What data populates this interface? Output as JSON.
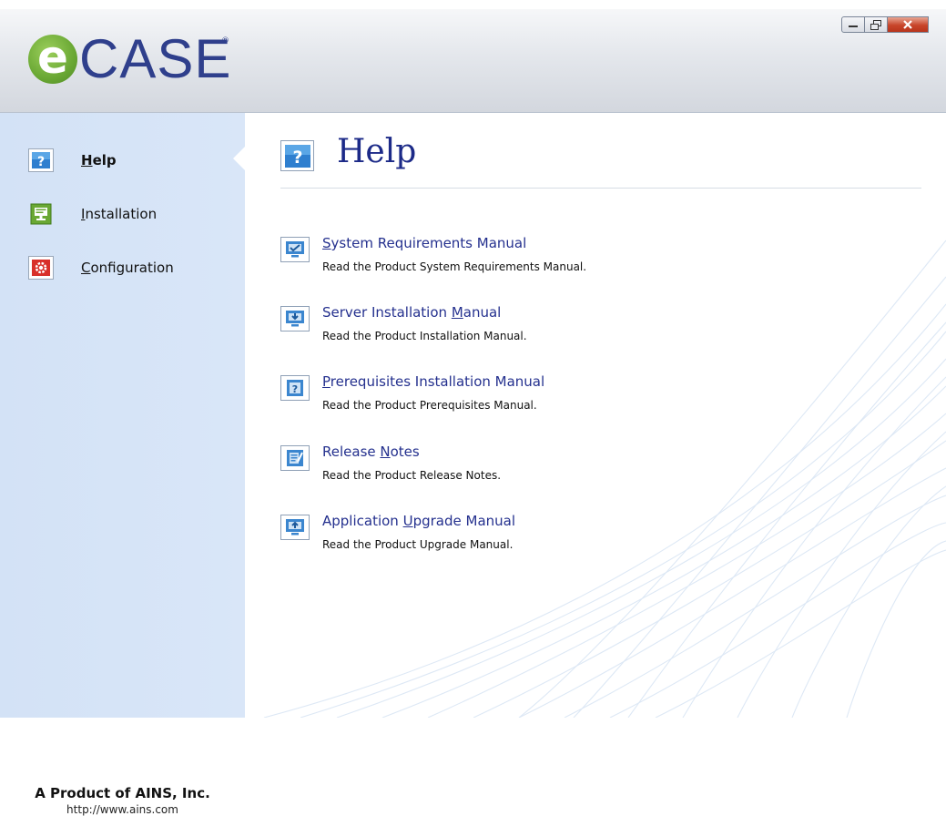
{
  "window": {
    "logo_e": "e",
    "logo_case": "CASE",
    "logo_mark": "®",
    "controls": {
      "minimize_icon": "minimize-icon",
      "restore_icon": "restore-icon",
      "close_icon": "close-icon"
    }
  },
  "sidebar": {
    "items": [
      {
        "label": "Help",
        "access_key": "H",
        "rest": "elp",
        "icon": "help-icon",
        "active": true
      },
      {
        "label": "Installation",
        "access_key": "I",
        "rest": "nstallation",
        "icon": "installation-icon",
        "active": false
      },
      {
        "label": "Configuration",
        "access_key": "C",
        "rest": "onfiguration",
        "icon": "configuration-icon",
        "active": false
      }
    ],
    "footer": {
      "company": "A Product of AINS, Inc.",
      "url": "http://www.ains.com"
    }
  },
  "main": {
    "title": "Help",
    "title_icon": "help-icon",
    "links": [
      {
        "pre": "",
        "key": "S",
        "post": "ystem Requirements Manual",
        "desc": "Read the Product System Requirements Manual.",
        "icon": "checklist-monitor-icon"
      },
      {
        "pre": "Server Installation ",
        "key": "M",
        "post": "anual",
        "desc": "Read the Product Installation Manual.",
        "icon": "download-monitor-icon"
      },
      {
        "pre": "",
        "key": "P",
        "post": "rerequisites Installation Manual",
        "desc": "Read the Product Prerequisites Manual.",
        "icon": "question-document-icon"
      },
      {
        "pre": "Release ",
        "key": "N",
        "post": "otes",
        "desc": "Read the Product Release Notes.",
        "icon": "notes-icon"
      },
      {
        "pre": "Application ",
        "key": "U",
        "post": "pgrade Manual",
        "desc": "Read the Product Upgrade Manual.",
        "icon": "upgrade-monitor-icon"
      }
    ]
  },
  "colors": {
    "sidebar_bg": "#d5e3f7",
    "title_color": "#1c2a88",
    "link_color": "#24308e",
    "logo_green": "#6aa834",
    "logo_blue": "#2f3f8c"
  }
}
